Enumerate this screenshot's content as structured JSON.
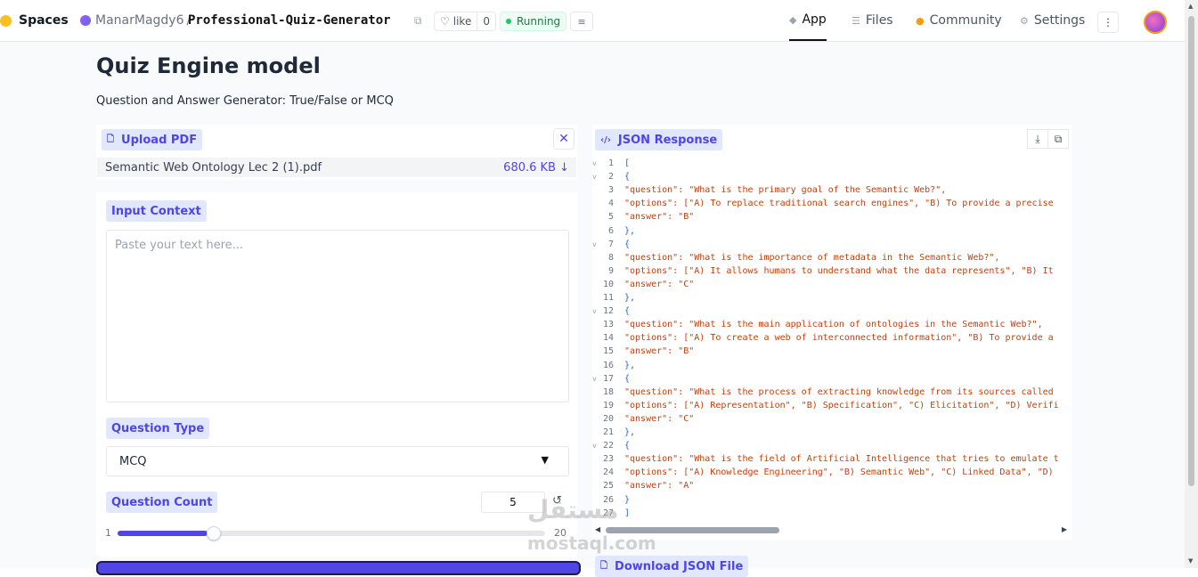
{
  "topbar": {
    "spaces": "Spaces",
    "owner": "ManarMagdy6",
    "separator": "/",
    "repo": "Professional-Quiz-Generator",
    "like_label": "like",
    "like_count": "0",
    "status": "Running",
    "nav": [
      {
        "label": "App",
        "icon": "cube-icon"
      },
      {
        "label": "Files",
        "icon": "files-icon"
      },
      {
        "label": "Community",
        "icon": "community-icon"
      },
      {
        "label": "Settings",
        "icon": "gear-icon"
      }
    ]
  },
  "page": {
    "title": "Quiz Engine model",
    "subtitle": "Question and Answer Generator: True/False or MCQ"
  },
  "upload": {
    "label": "Upload PDF",
    "file_name": "Semantic Web Ontology Lec 2 (1).pdf",
    "file_size": "680.6 KB ↓"
  },
  "context": {
    "label": "Input Context",
    "placeholder": "Paste your text here..."
  },
  "question_type": {
    "label": "Question Type",
    "value": "MCQ"
  },
  "question_count": {
    "label": "Question Count",
    "value": "5",
    "min": "1",
    "max": "20",
    "level": 0.2105
  },
  "json_panel": {
    "label": "JSON Response",
    "lines": [
      {
        "n": "1",
        "t": "[",
        "p": true,
        "fold": "v"
      },
      {
        "n": "2",
        "t": "  {",
        "p": true,
        "fold": "v"
      },
      {
        "n": "3",
        "t": "    \"question\": \"What is the primary goal of the Semantic Web?\",",
        "p": false,
        "fold": ""
      },
      {
        "n": "4",
        "t": "    \"options\": [\"A) To replace traditional search engines\", \"B) To provide a precise",
        "p": false,
        "fold": ""
      },
      {
        "n": "5",
        "t": "    \"answer\": \"B\"",
        "p": false,
        "fold": ""
      },
      {
        "n": "6",
        "t": "  },",
        "p": true,
        "fold": ""
      },
      {
        "n": "7",
        "t": "  {",
        "p": true,
        "fold": "v"
      },
      {
        "n": "8",
        "t": "    \"question\": \"What is the importance of metadata in the Semantic Web?\",",
        "p": false,
        "fold": ""
      },
      {
        "n": "9",
        "t": "    \"options\": [\"A) It allows humans to understand what the data represents\", \"B) It",
        "p": false,
        "fold": ""
      },
      {
        "n": "10",
        "t": "    \"answer\": \"C\"",
        "p": false,
        "fold": ""
      },
      {
        "n": "11",
        "t": "  },",
        "p": true,
        "fold": ""
      },
      {
        "n": "12",
        "t": "  {",
        "p": true,
        "fold": "v"
      },
      {
        "n": "13",
        "t": "    \"question\": \"What is the main application of ontologies in the Semantic Web?\",",
        "p": false,
        "fold": ""
      },
      {
        "n": "14",
        "t": "    \"options\": [\"A) To create a web of interconnected information\", \"B) To provide a",
        "p": false,
        "fold": ""
      },
      {
        "n": "15",
        "t": "    \"answer\": \"B\"",
        "p": false,
        "fold": ""
      },
      {
        "n": "16",
        "t": "  },",
        "p": true,
        "fold": ""
      },
      {
        "n": "17",
        "t": "  {",
        "p": true,
        "fold": "v"
      },
      {
        "n": "18",
        "t": "    \"question\": \"What is the process of extracting knowledge from its sources called",
        "p": false,
        "fold": ""
      },
      {
        "n": "19",
        "t": "    \"options\": [\"A) Representation\", \"B) Specification\", \"C) Elicitation\", \"D) Verifi",
        "p": false,
        "fold": ""
      },
      {
        "n": "20",
        "t": "    \"answer\": \"C\"",
        "p": false,
        "fold": ""
      },
      {
        "n": "21",
        "t": "  },",
        "p": true,
        "fold": ""
      },
      {
        "n": "22",
        "t": "  {",
        "p": true,
        "fold": "v"
      },
      {
        "n": "23",
        "t": "    \"question\": \"What is the field of Artificial Intelligence that tries to emulate t",
        "p": false,
        "fold": ""
      },
      {
        "n": "24",
        "t": "    \"options\": [\"A) Knowledge Engineering\", \"B) Semantic Web\", \"C) Linked Data\", \"D)",
        "p": false,
        "fold": ""
      },
      {
        "n": "25",
        "t": "    \"answer\": \"A\"",
        "p": false,
        "fold": ""
      },
      {
        "n": "26",
        "t": "  }",
        "p": true,
        "fold": ""
      },
      {
        "n": "27",
        "t": "]",
        "p": true,
        "fold": ""
      }
    ]
  },
  "download": {
    "label": "Download JSON File"
  },
  "watermark": {
    "line1": "مستقل",
    "line2": "mostaql.com"
  },
  "colors": {
    "accent": "#4f46e5",
    "label_bg": "#e0e7ff",
    "running": "#15803d"
  }
}
